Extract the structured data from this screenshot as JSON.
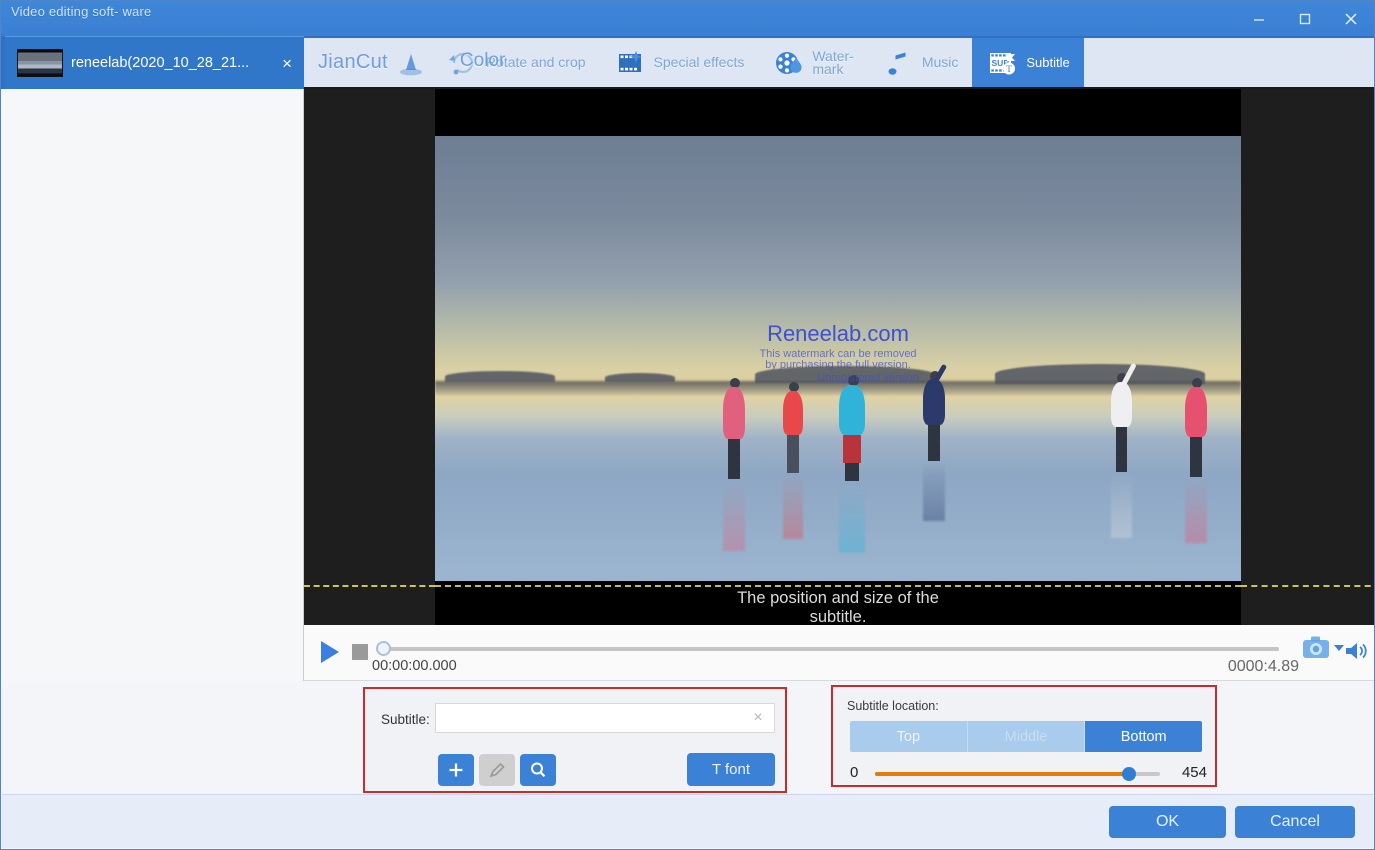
{
  "window": {
    "app_title": "Video editing soft-\nware",
    "minimize_label": "Minimize",
    "maximize_label": "Maximize",
    "close_label": "Close"
  },
  "file_tab": {
    "name": "reneelab(2020_10_28_21...",
    "close_label": "×"
  },
  "toolbar": {
    "brand_label": "JianCut",
    "color_ghost_label": "Color",
    "items": [
      {
        "label": "Rotate and crop",
        "icon": "rotate-crop-icon",
        "active": false
      },
      {
        "label": "Special effects",
        "icon": "special-effects-icon",
        "active": false
      },
      {
        "label": "Water-\nmark",
        "icon": "watermark-icon",
        "active": false
      },
      {
        "label": "Music",
        "icon": "music-note-icon",
        "active": false
      },
      {
        "label": "Subtitle",
        "icon": "subtitle-icon",
        "active": true
      }
    ]
  },
  "preview": {
    "watermark_main": "Reneelab.com",
    "watermark_sub": "This watermark can be removed\nby purchasing the full version.",
    "watermark_unregistered": "Unregistered version",
    "subtitle_placeholder_text": "The position and size of the\nsubtitle."
  },
  "player": {
    "play_label": "Play",
    "stop_label": "Stop",
    "current_time": "00:00:00.000",
    "duration": "0000:4.89",
    "snapshot_label": "Snapshot",
    "snapshot_caret_label": "Snapshot options",
    "volume_label": "Volume",
    "seek_value": 0
  },
  "subtitle_panel": {
    "label": "Subtitle:",
    "input_value": "",
    "input_placeholder": "",
    "clear_label": "×",
    "add_label": "+",
    "edit_label": "Edit",
    "find_label": "Find",
    "font_label": "T font"
  },
  "location_panel": {
    "label": "Subtitle location:",
    "options": [
      {
        "label": "Top",
        "selected": false
      },
      {
        "label": "Middle",
        "selected": false
      },
      {
        "label": "Bottom",
        "selected": true
      }
    ],
    "slider_min": "0",
    "slider_max": "454",
    "slider_value": 404
  },
  "footer": {
    "ok_label": "OK",
    "cancel_label": "Cancel"
  },
  "colors": {
    "accent_blue": "#3b82d6",
    "title_blue": "#3f86d8",
    "slider_orange": "#e8790c",
    "box_red": "#c92b2b",
    "guide_yellow": "#d3c44b"
  }
}
